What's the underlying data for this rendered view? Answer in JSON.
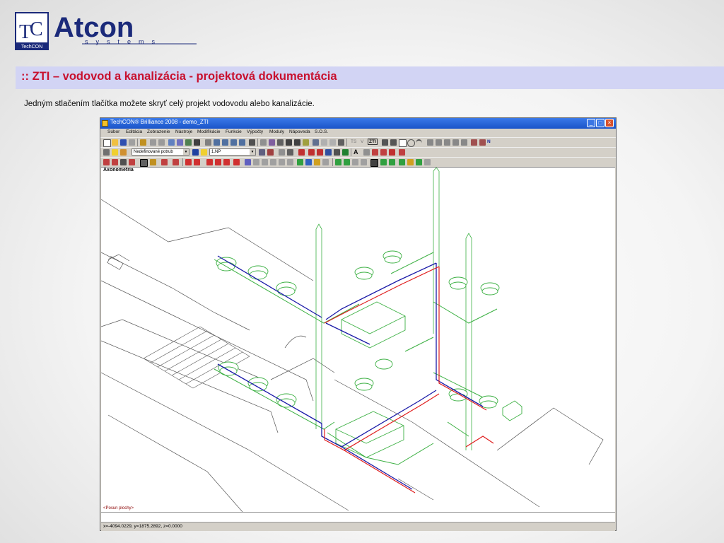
{
  "logo": {
    "mark": "TC",
    "mark_caption": "TechCON",
    "brand": "Atcon",
    "brand_sub": "s y s t e m s"
  },
  "slide": {
    "title": ":: ZTI – vodovod a kanalizácia - projektová dokumentácia",
    "subtitle": "Jedným stlačením tlačítka možete skryť celý projekt vodovodu alebo kanalizácie."
  },
  "colors": {
    "title_band": "#d2d4f4",
    "title_text": "#c8102e",
    "titlebar": "#1b54c9",
    "pipe_green": "#3cb043",
    "pipe_blue": "#1a1aa8",
    "pipe_red": "#e01e1e"
  },
  "app": {
    "window_title": "TechCON® Brilliance 2008   - demo_ZTI",
    "window_buttons": [
      "minimize-icon",
      "maximize-icon",
      "close-icon"
    ],
    "menu": [
      "Súbor",
      "Editácia",
      "Zobrazenie",
      "Nástroje",
      "Modifikácie",
      "Funkcie",
      "Výpočty",
      "Moduly",
      "Nápoveda",
      "S.O.S."
    ],
    "toolbar1": {
      "ts_label": "TS",
      "v_label": "V",
      "zti_label": "ZTI",
      "n_label": "N"
    },
    "toolbar2": {
      "pipe_type": "Nedefinované potrub",
      "floor": "1.NP",
      "a_label": "A"
    },
    "viewport_label": "Axonometria",
    "hint": "<Posun plochy>",
    "coords": "x=-4094.0229, y=1875.2892, z=0.0000"
  }
}
